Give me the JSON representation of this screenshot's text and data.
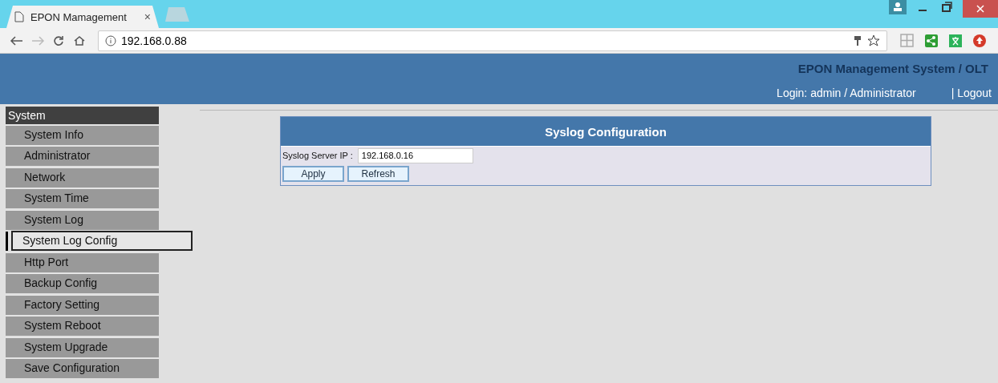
{
  "browser": {
    "tab_title": "EPON Mamagement",
    "tab_close": "×",
    "address": "192.168.0.88"
  },
  "header": {
    "title": "EPON Management System / OLT",
    "login": "Login: admin / Administrator",
    "logout": "| Logout"
  },
  "sidebar": {
    "section": "System",
    "items": [
      {
        "label": "System Info",
        "selected": false
      },
      {
        "label": "Administrator",
        "selected": false
      },
      {
        "label": "Network",
        "selected": false
      },
      {
        "label": "System Time",
        "selected": false
      },
      {
        "label": "System Log",
        "selected": false
      },
      {
        "label": "System Log Config",
        "selected": true
      },
      {
        "label": "Http Port",
        "selected": false
      },
      {
        "label": "Backup Config",
        "selected": false
      },
      {
        "label": "Factory Setting",
        "selected": false
      },
      {
        "label": "System Reboot",
        "selected": false
      },
      {
        "label": "System Upgrade",
        "selected": false
      },
      {
        "label": "Save Configuration",
        "selected": false
      }
    ]
  },
  "panel": {
    "title": "Syslog Configuration",
    "field_label": "Syslog Server IP :",
    "field_value": "192.168.0.16",
    "buttons": [
      "Apply",
      "Refresh"
    ]
  }
}
